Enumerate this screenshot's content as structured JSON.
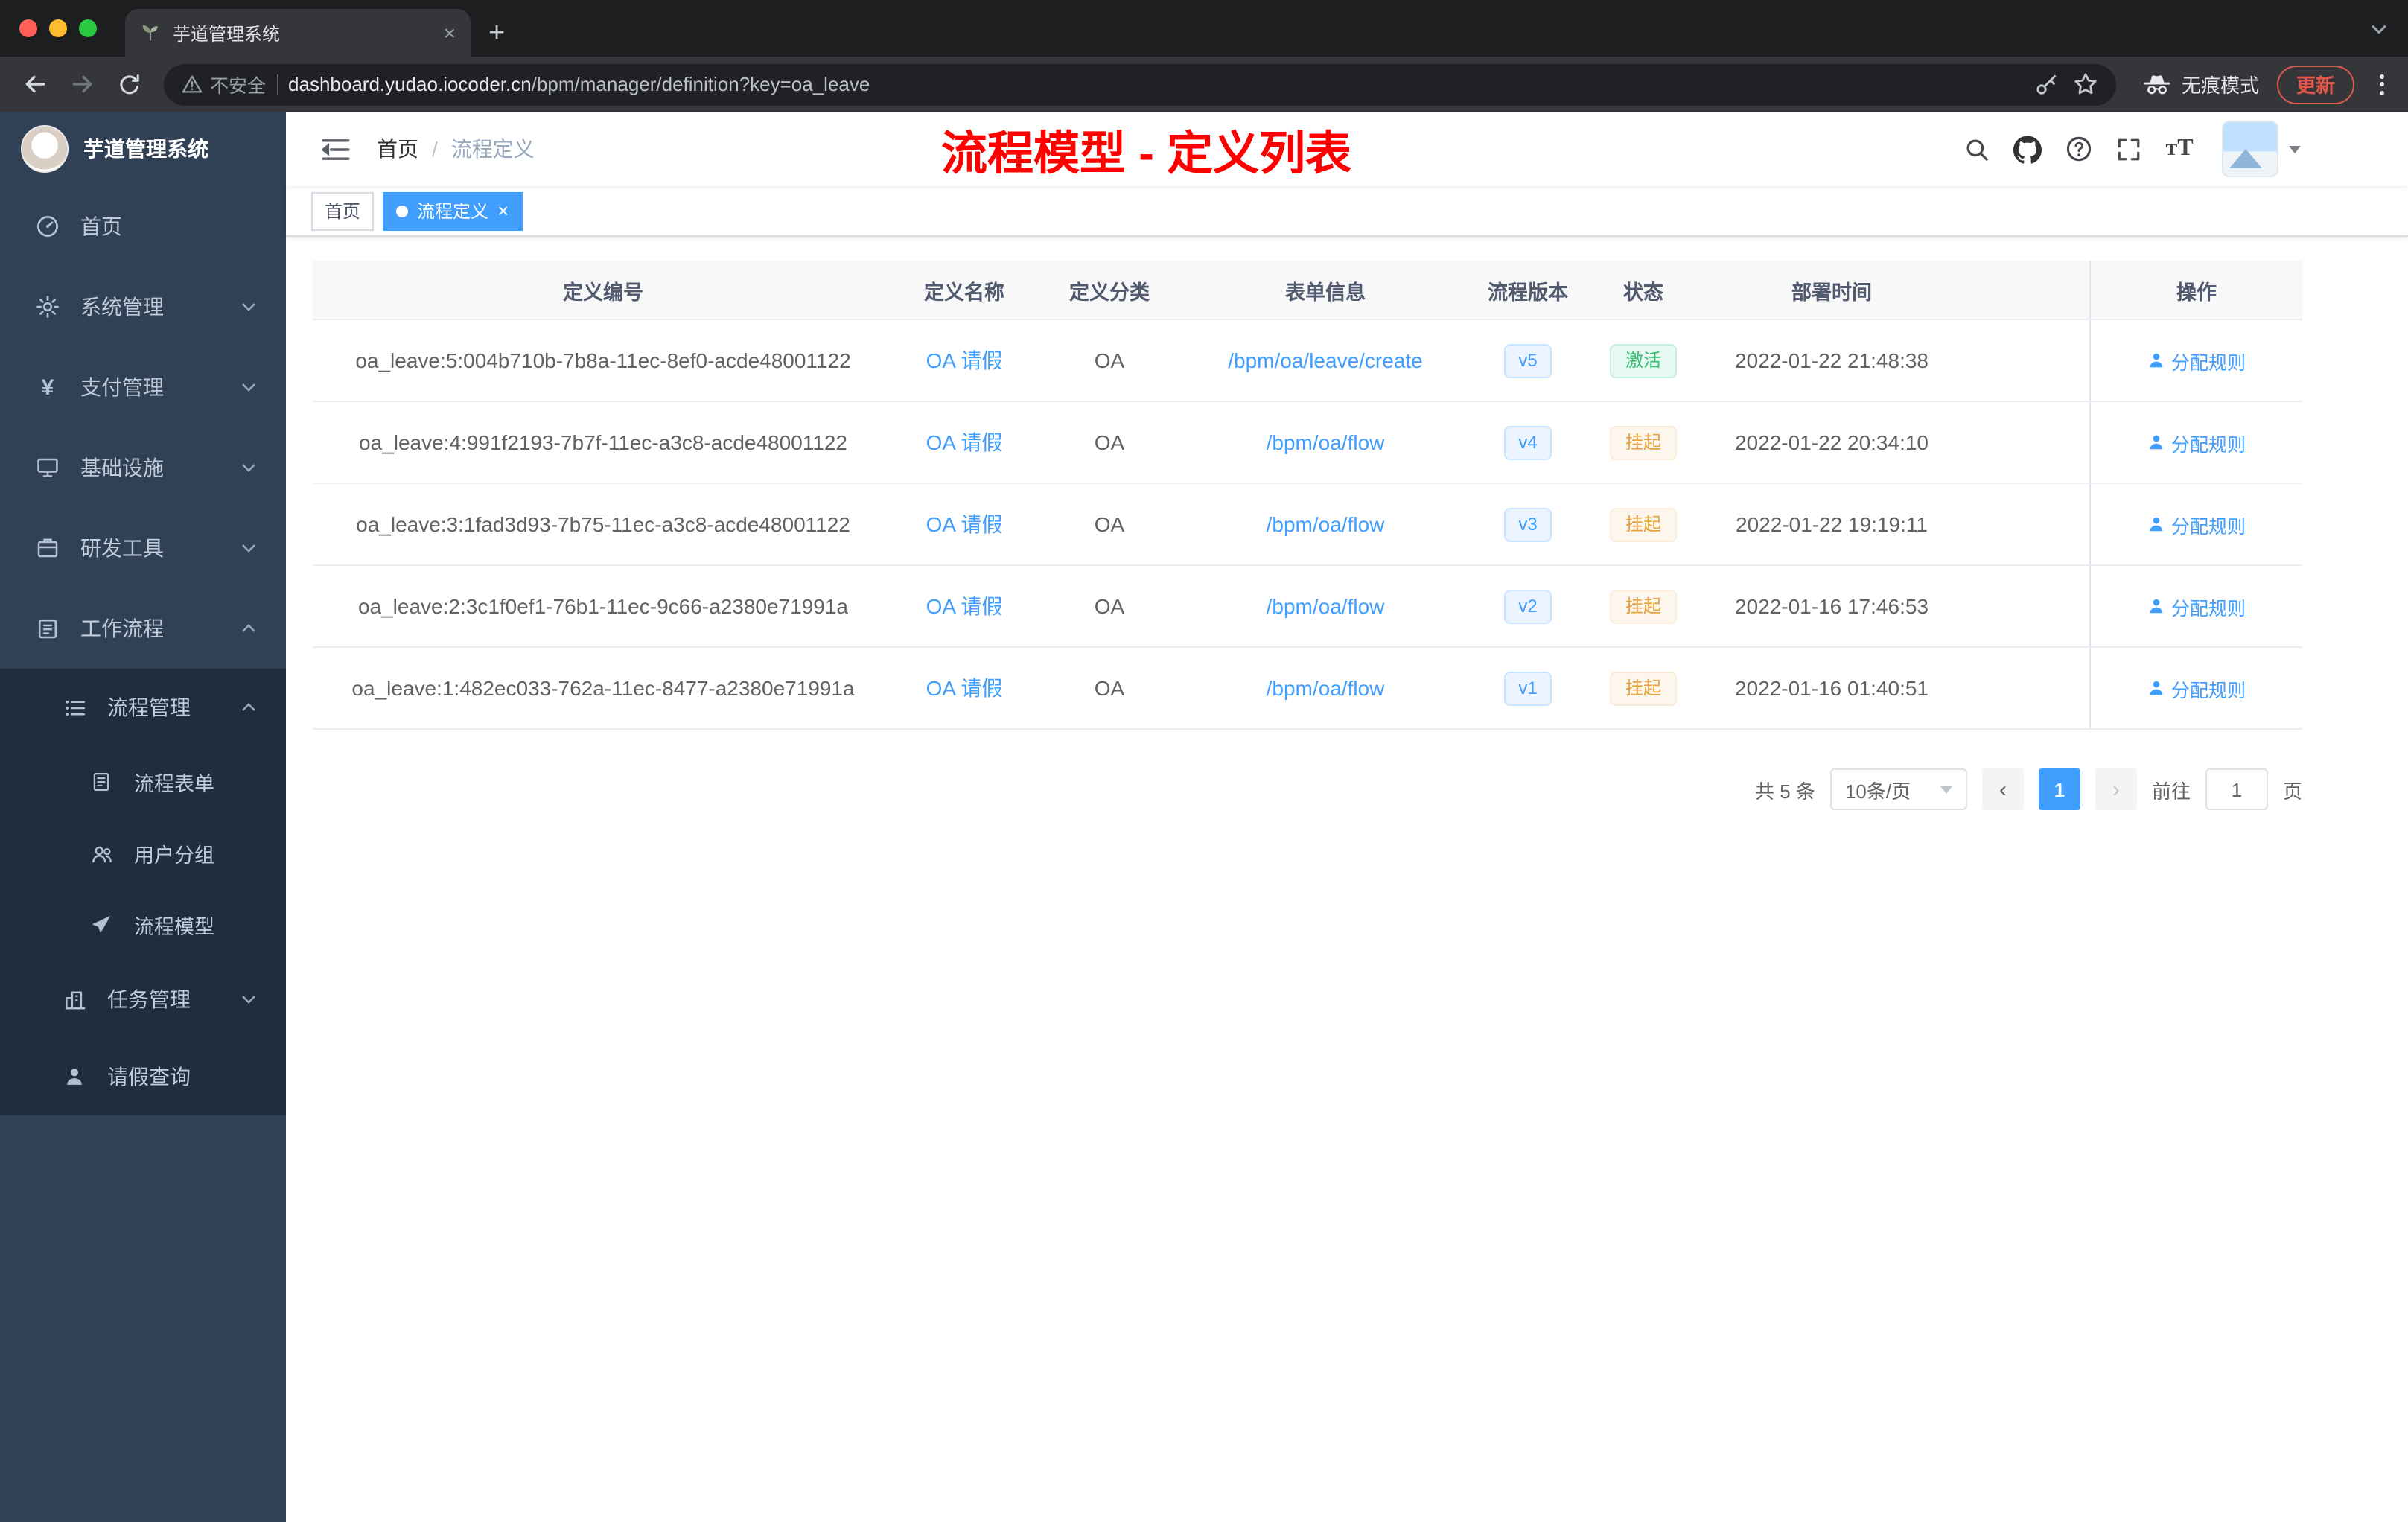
{
  "browser": {
    "tab": {
      "title": "芋道管理系统",
      "close_glyph": "×",
      "new_tab_glyph": "+"
    },
    "address": {
      "security_label": "不安全",
      "url_host": "dashboard.yudao.iocoder.cn",
      "url_path": "/bpm/manager/definition?key=oa_leave"
    },
    "incognito_label": "无痕模式",
    "update_label": "更新"
  },
  "sidebar": {
    "logo_title": "芋道管理系统",
    "items": [
      {
        "label": "首页"
      },
      {
        "label": "系统管理"
      },
      {
        "label": "支付管理"
      },
      {
        "label": "基础设施"
      },
      {
        "label": "研发工具"
      },
      {
        "label": "工作流程"
      }
    ],
    "submenu": {
      "group1": "流程管理",
      "group1_children": [
        "流程表单",
        "用户分组",
        "流程模型"
      ],
      "group2": "任务管理",
      "leaf": "请假查询"
    }
  },
  "navbar": {
    "breadcrumb_home": "首页",
    "breadcrumb_separator": "/",
    "breadcrumb_current": "流程定义",
    "annotation": "流程模型 - 定义列表"
  },
  "tags": [
    {
      "label": "首页"
    },
    {
      "label": "流程定义"
    }
  ],
  "table": {
    "headers": [
      "定义编号",
      "定义名称",
      "定义分类",
      "表单信息",
      "流程版本",
      "状态",
      "部署时间",
      "操作"
    ],
    "rows": [
      {
        "id": "oa_leave:5:004b710b-7b8a-11ec-8ef0-acde48001122",
        "name": "OA 请假",
        "category": "OA",
        "form": "/bpm/oa/leave/create",
        "version": "v5",
        "status": "激活",
        "time": "2022-01-22 21:48:38",
        "action": "分配规则"
      },
      {
        "id": "oa_leave:4:991f2193-7b7f-11ec-a3c8-acde48001122",
        "name": "OA 请假",
        "category": "OA",
        "form": "/bpm/oa/flow",
        "version": "v4",
        "status": "挂起",
        "time": "2022-01-22 20:34:10",
        "action": "分配规则"
      },
      {
        "id": "oa_leave:3:1fad3d93-7b75-11ec-a3c8-acde48001122",
        "name": "OA 请假",
        "category": "OA",
        "form": "/bpm/oa/flow",
        "version": "v3",
        "status": "挂起",
        "time": "2022-01-22 19:19:11",
        "action": "分配规则"
      },
      {
        "id": "oa_leave:2:3c1f0ef1-76b1-11ec-9c66-a2380e71991a",
        "name": "OA 请假",
        "category": "OA",
        "form": "/bpm/oa/flow",
        "version": "v2",
        "status": "挂起",
        "time": "2022-01-16 17:46:53",
        "action": "分配规则"
      },
      {
        "id": "oa_leave:1:482ec033-762a-11ec-8477-a2380e71991a",
        "name": "OA 请假",
        "category": "OA",
        "form": "/bpm/oa/flow",
        "version": "v1",
        "status": "挂起",
        "time": "2022-01-16 01:40:51",
        "action": "分配规则"
      }
    ]
  },
  "pagination": {
    "total": "共 5 条",
    "page_size": "10条/页",
    "prev_glyph": "‹",
    "current_page": "1",
    "next_glyph": "›",
    "goto_label": "前往",
    "goto_value": "1",
    "page_unit": "页"
  }
}
